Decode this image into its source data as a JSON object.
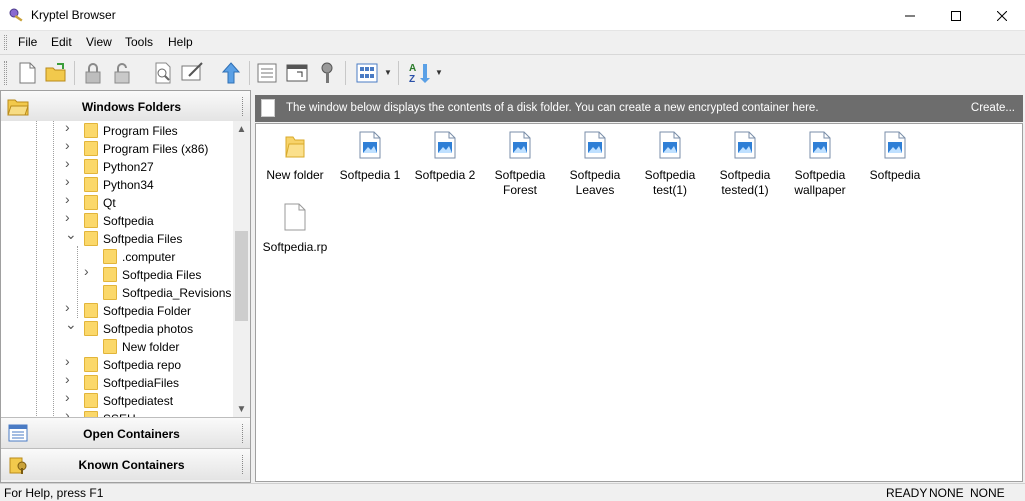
{
  "window": {
    "title": "Kryptel Browser"
  },
  "menu": [
    "File",
    "Edit",
    "View",
    "Tools",
    "Help"
  ],
  "left_panel": {
    "folders_header": "Windows Folders",
    "tree": [
      {
        "label": "Program Files",
        "chevron": ">"
      },
      {
        "label": "Program Files (x86)",
        "chevron": ">"
      },
      {
        "label": "Python27",
        "chevron": ">"
      },
      {
        "label": "Python34",
        "chevron": ">"
      },
      {
        "label": "Qt",
        "chevron": ">"
      },
      {
        "label": "Softpedia",
        "chevron": ">"
      },
      {
        "label": "Softpedia Files",
        "chevron": "v"
      },
      {
        "label": ".computer",
        "chevron": ""
      },
      {
        "label": "Softpedia Files",
        "chevron": ">"
      },
      {
        "label": "Softpedia_Revisions",
        "chevron": ""
      },
      {
        "label": "Softpedia Folder",
        "chevron": ">"
      },
      {
        "label": "Softpedia photos",
        "chevron": "v"
      },
      {
        "label": "New folder",
        "chevron": ""
      },
      {
        "label": "Softpedia repo",
        "chevron": ">"
      },
      {
        "label": "SoftpediaFiles",
        "chevron": ">"
      },
      {
        "label": "Softpediatest",
        "chevron": ">"
      },
      {
        "label": "SSEH",
        "chevron": ">"
      }
    ],
    "open_containers": "Open Containers",
    "known_containers": "Known Containers"
  },
  "banner": {
    "text": "The window below displays the contents of a disk folder. You can create a new encrypted container here.",
    "link": "Create..."
  },
  "files": [
    {
      "name": "New folder",
      "type": "folder"
    },
    {
      "name": "Softpedia 1",
      "type": "image"
    },
    {
      "name": "Softpedia 2",
      "type": "image"
    },
    {
      "name": "Softpedia Forest",
      "type": "image"
    },
    {
      "name": "Softpedia Leaves",
      "type": "image"
    },
    {
      "name": "Softpedia test(1)",
      "type": "image"
    },
    {
      "name": "Softpedia tested(1)",
      "type": "image"
    },
    {
      "name": "Softpedia wallpaper",
      "type": "image"
    },
    {
      "name": "Softpedia",
      "type": "image"
    },
    {
      "name": "Softpedia.rp",
      "type": "file"
    }
  ],
  "status": {
    "help": "For Help, press F1",
    "state": "READY",
    "cell2": "NONE",
    "cell3": "NONE"
  }
}
